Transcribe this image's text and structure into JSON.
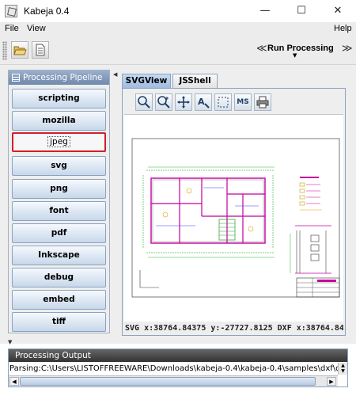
{
  "window": {
    "title": "Kabeja 0.4",
    "controls": [
      "—",
      "☐",
      "✕"
    ]
  },
  "menu": {
    "file": "File",
    "view": "View",
    "help": "Help"
  },
  "toolbar": {
    "run_label": "Run Processing",
    "run_prev": "≪",
    "run_next": "≫",
    "run_dropdown": "▼"
  },
  "pipeline": {
    "header": "Processing Pipeline",
    "items": [
      {
        "label": "scripting"
      },
      {
        "label": "mozilla"
      },
      {
        "label": "jpeg",
        "selected": true
      },
      {
        "label": "svg"
      },
      {
        "label": "png"
      },
      {
        "label": "font"
      },
      {
        "label": "pdf"
      },
      {
        "label": "Inkscape"
      },
      {
        "label": "debug"
      },
      {
        "label": "embed"
      },
      {
        "label": "tiff"
      }
    ]
  },
  "tabs": [
    {
      "label": "SVGView",
      "active": true
    },
    {
      "label": "JSShell",
      "active": false
    }
  ],
  "svg_view": {
    "tools": [
      "zoom-icon",
      "zoom-in-icon",
      "pan-icon",
      "text-zoom-icon",
      "select-rect-icon",
      "ms-icon",
      "print-icon"
    ],
    "ms_label": "MS",
    "status": "SVG  x:38764.84375  y:-27727.8125   DXF x:38764.843..."
  },
  "output": {
    "header": "Processing Output",
    "text": "Parsing:C:\\Users\\LISTOFFREEWARE\\Downloads\\kabeja-0.4\\kabeja-0.4\\samples\\dxf\\d"
  }
}
